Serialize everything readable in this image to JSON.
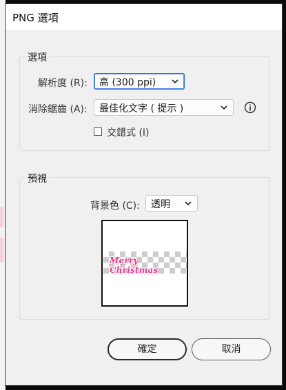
{
  "window": {
    "title": "PNG 選項"
  },
  "options_group": {
    "legend": "選項",
    "resolution": {
      "label": "解析度 (R):",
      "value": "高 (300 ppi)"
    },
    "antialias": {
      "label": "消除鋸齒 (A):",
      "value": "最佳化文字 ( 提示 )"
    },
    "interlaced": {
      "label": "交錯式 (I)",
      "checked": false
    }
  },
  "preview_group": {
    "legend": "預視",
    "background": {
      "label": "背景色 (C):",
      "value": "透明"
    },
    "preview_art_text": "Merry Christmas"
  },
  "buttons": {
    "ok": "確定",
    "cancel": "取消"
  },
  "icons": {
    "info": "info-icon",
    "chevron": "chevron-down-icon"
  },
  "colors": {
    "focus_border": "#2d6fd6",
    "art_pink": "#e8398b"
  }
}
